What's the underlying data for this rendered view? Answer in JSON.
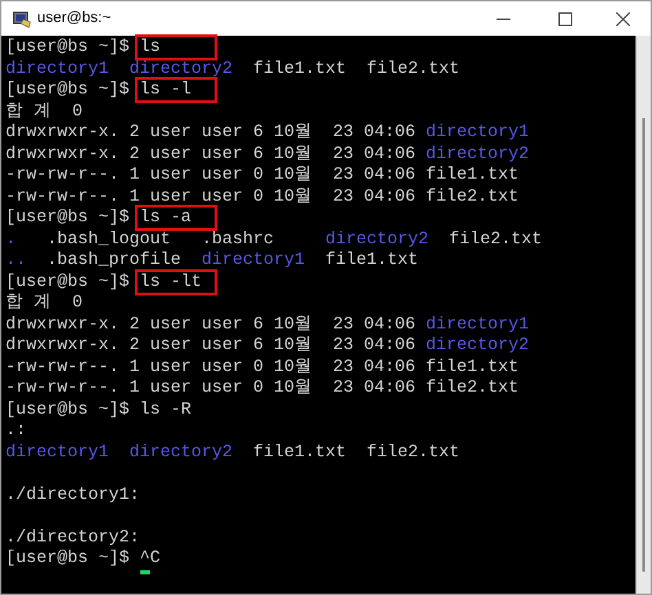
{
  "window": {
    "title": "user@bs:~"
  },
  "lines": [
    {
      "kind": "prompt",
      "prompt": "[user@bs ~]$",
      "command": "ls",
      "highlighted": true,
      "cursor": false
    },
    {
      "kind": "ls",
      "segments": [
        {
          "text": "directory1",
          "kind": "dir"
        },
        {
          "text": "directory2",
          "kind": "dir"
        },
        {
          "text": "file1.txt",
          "kind": "file"
        },
        {
          "text": "file2.txt",
          "kind": "file"
        }
      ]
    },
    {
      "kind": "prompt",
      "prompt": "[user@bs ~]$",
      "command": "ls -l",
      "highlighted": true,
      "cursor": false
    },
    {
      "kind": "text",
      "segments": [
        {
          "text": "합 계  0",
          "kind": "file"
        }
      ]
    },
    {
      "kind": "text",
      "segments": [
        {
          "text": "drwxrwxr-x. 2 user user 6 10월  23 04:06",
          "kind": "file"
        },
        {
          "text": "directory1",
          "kind": "dir"
        }
      ]
    },
    {
      "kind": "text",
      "segments": [
        {
          "text": "drwxrwxr-x. 2 user user 6 10월  23 04:06",
          "kind": "file"
        },
        {
          "text": "directory2",
          "kind": "dir"
        }
      ]
    },
    {
      "kind": "text",
      "segments": [
        {
          "text": "-rw-rw-r--. 1 user user 0 10월  23 04:06",
          "kind": "file"
        },
        {
          "text": "file1.txt",
          "kind": "file"
        }
      ]
    },
    {
      "kind": "text",
      "segments": [
        {
          "text": "-rw-rw-r--. 1 user user 0 10월  23 04:06",
          "kind": "file"
        },
        {
          "text": "file2.txt",
          "kind": "file"
        }
      ]
    },
    {
      "kind": "prompt",
      "prompt": "[user@bs ~]$",
      "command": "ls -a",
      "highlighted": true,
      "cursor": false
    },
    {
      "kind": "grid",
      "segments": [
        {
          "text": ".",
          "kind": "dir"
        },
        {
          "text": ".bash_logout",
          "kind": "file"
        },
        {
          "text": ".bashrc",
          "kind": "file"
        },
        {
          "text": "directory2",
          "kind": "dir"
        },
        {
          "text": "file2.txt",
          "kind": "file"
        }
      ]
    },
    {
      "kind": "grid",
      "segments": [
        {
          "text": "..",
          "kind": "dir"
        },
        {
          "text": ".bash_profile",
          "kind": "file"
        },
        {
          "text": "directory1",
          "kind": "dir"
        },
        {
          "text": "file1.txt",
          "kind": "file"
        }
      ]
    },
    {
      "kind": "prompt",
      "prompt": "[user@bs ~]$",
      "command": "ls -lt",
      "highlighted": true,
      "cursor": false
    },
    {
      "kind": "text",
      "segments": [
        {
          "text": "합 계  0",
          "kind": "file"
        }
      ]
    },
    {
      "kind": "text",
      "segments": [
        {
          "text": "drwxrwxr-x. 2 user user 6 10월  23 04:06",
          "kind": "file"
        },
        {
          "text": "directory1",
          "kind": "dir"
        }
      ]
    },
    {
      "kind": "text",
      "segments": [
        {
          "text": "drwxrwxr-x. 2 user user 6 10월  23 04:06",
          "kind": "file"
        },
        {
          "text": "directory2",
          "kind": "dir"
        }
      ]
    },
    {
      "kind": "text",
      "segments": [
        {
          "text": "-rw-rw-r--. 1 user user 0 10월  23 04:06",
          "kind": "file"
        },
        {
          "text": "file1.txt",
          "kind": "file"
        }
      ]
    },
    {
      "kind": "text",
      "segments": [
        {
          "text": "-rw-rw-r--. 1 user user 0 10월  23 04:06",
          "kind": "file"
        },
        {
          "text": "file2.txt",
          "kind": "file"
        }
      ]
    },
    {
      "kind": "prompt",
      "prompt": "[user@bs ~]$",
      "command": "ls -R",
      "highlighted": false,
      "cursor": false
    },
    {
      "kind": "text",
      "segments": [
        {
          "text": ".:",
          "kind": "file"
        }
      ]
    },
    {
      "kind": "ls",
      "segments": [
        {
          "text": "directory1",
          "kind": "dir"
        },
        {
          "text": "directory2",
          "kind": "dir"
        },
        {
          "text": "file1.txt",
          "kind": "file"
        },
        {
          "text": "file2.txt",
          "kind": "file"
        }
      ]
    },
    {
      "kind": "blank"
    },
    {
      "kind": "text",
      "segments": [
        {
          "text": "./directory1:",
          "kind": "file"
        }
      ]
    },
    {
      "kind": "blank"
    },
    {
      "kind": "text",
      "segments": [
        {
          "text": "./directory2:",
          "kind": "file"
        }
      ]
    },
    {
      "kind": "prompt",
      "prompt": "[user@bs ~]$",
      "command": "^C",
      "highlighted": false,
      "cursor": true
    }
  ]
}
